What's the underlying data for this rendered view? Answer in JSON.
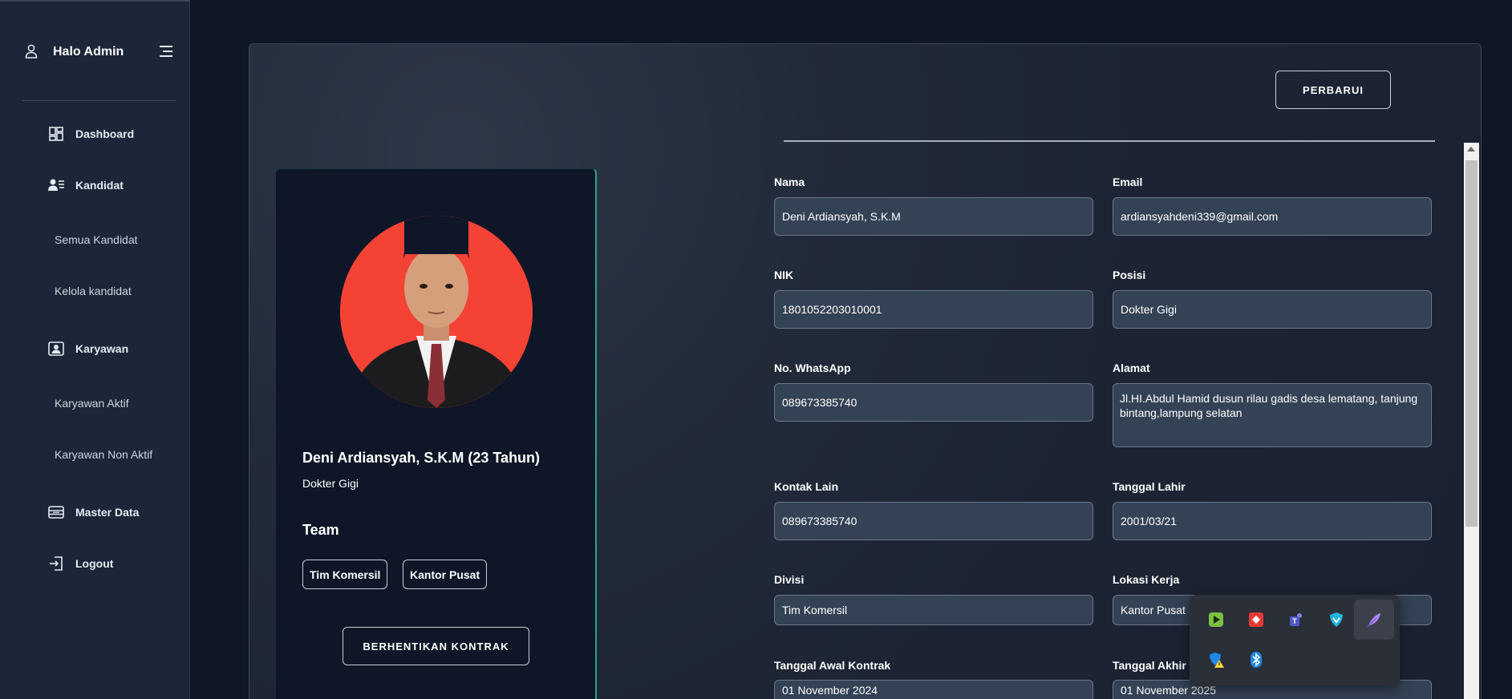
{
  "sidebar": {
    "title": "Halo Admin",
    "items": {
      "dashboard": "Dashboard",
      "kandidat": "Kandidat",
      "semua_kandidat": "Semua Kandidat",
      "kelola_kandidat": "Kelola kandidat",
      "karyawan": "Karyawan",
      "karyawan_aktif": "Karyawan Aktif",
      "karyawan_non_aktif": "Karyawan Non Aktif",
      "master_data": "Master Data",
      "logout": "Logout"
    }
  },
  "actions": {
    "update_label": "PERBARUI",
    "stop_contract_label": "BERHENTIKAN KONTRAK"
  },
  "profile": {
    "name": "Deni Ardiansyah, S.K.M (23 Tahun)",
    "role": "Dokter Gigi",
    "team_heading": "Team",
    "teams": [
      "Tim Komersil",
      "Kantor Pusat"
    ]
  },
  "form": {
    "nama": {
      "label": "Nama",
      "value": "Deni Ardiansyah, S.K.M"
    },
    "email": {
      "label": "Email",
      "value": "ardiansyahdeni339@gmail.com"
    },
    "nik": {
      "label": "NIK",
      "value": "1801052203010001"
    },
    "posisi": {
      "label": "Posisi",
      "value": "Dokter Gigi"
    },
    "whatsapp": {
      "label": "No. WhatsApp",
      "value": "089673385740"
    },
    "alamat": {
      "label": "Alamat",
      "value": "Jl.HI.Abdul Hamid dusun rilau gadis desa lematang, tanjung bintang,lampung selatan"
    },
    "kontak_lain": {
      "label": "Kontak Lain",
      "value": "089673385740"
    },
    "tanggal_lahir": {
      "label": "Tanggal Lahir",
      "value": "2001/03/21"
    },
    "divisi": {
      "label": "Divisi",
      "value": "Tim Komersil"
    },
    "lokasi_kerja": {
      "label": "Lokasi Kerja",
      "value": "Kantor Pusat"
    },
    "tanggal_awal": {
      "label": "Tanggal Awal Kontrak",
      "value": "01 November 2024"
    },
    "tanggal_akhir": {
      "label": "Tanggal Akhir K",
      "value": "01 November 2025"
    }
  },
  "tray": {
    "icons": [
      "nvidia-icon",
      "anydesk-icon",
      "teams-icon",
      "vpn-shield-icon",
      "feather-icon",
      "defender-warning-icon",
      "bluetooth-icon"
    ]
  },
  "colors": {
    "sidebar_bg": "#1b2638",
    "input_bg": "#344256",
    "accent_green": "#2aa48a",
    "avatar_bg": "#f44335"
  }
}
